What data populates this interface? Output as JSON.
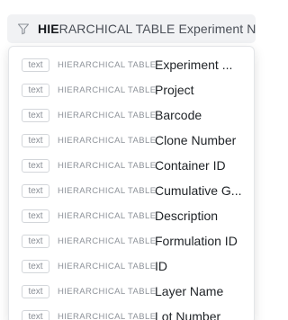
{
  "filter": {
    "typed_text": "HIE",
    "rest_text": "RARCHICAL TABLE Experiment N"
  },
  "options": [
    {
      "type": "text",
      "table": "HIERARCHICAL TABLE",
      "label": "Experiment ..."
    },
    {
      "type": "text",
      "table": "HIERARCHICAL TABLE",
      "label": "Project"
    },
    {
      "type": "text",
      "table": "HIERARCHICAL TABLE",
      "label": "Barcode"
    },
    {
      "type": "text",
      "table": "HIERARCHICAL TABLE",
      "label": "Clone Number"
    },
    {
      "type": "text",
      "table": "HIERARCHICAL TABLE",
      "label": "Container ID"
    },
    {
      "type": "text",
      "table": "HIERARCHICAL TABLE",
      "label": "Cumulative G..."
    },
    {
      "type": "text",
      "table": "HIERARCHICAL TABLE",
      "label": "Description"
    },
    {
      "type": "text",
      "table": "HIERARCHICAL TABLE",
      "label": "Formulation ID"
    },
    {
      "type": "text",
      "table": "HIERARCHICAL TABLE",
      "label": "ID"
    },
    {
      "type": "text",
      "table": "HIERARCHICAL TABLE",
      "label": "Layer Name"
    },
    {
      "type": "text",
      "table": "HIERARCHICAL TABLE",
      "label": "Lot Number"
    }
  ]
}
